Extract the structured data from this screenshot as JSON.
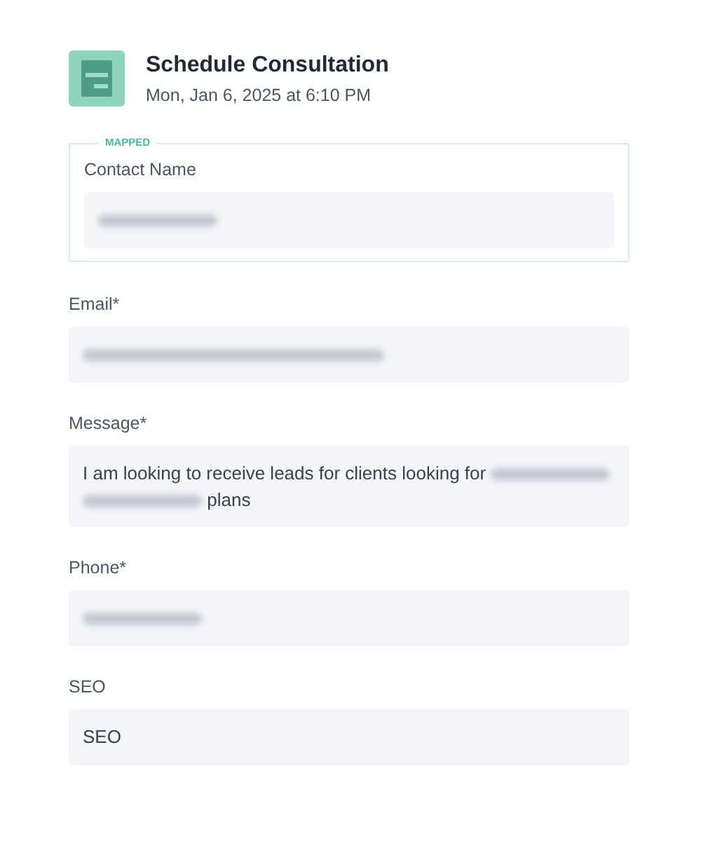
{
  "header": {
    "title": "Schedule Consultation",
    "subtitle": "Mon, Jan 6, 2025 at 6:10 PM"
  },
  "fields": [
    {
      "label": "Contact Name",
      "badge": "MAPPED",
      "parts": [
        {
          "kind": "redacted",
          "wide": false
        }
      ]
    },
    {
      "label": "Email*",
      "parts": [
        {
          "kind": "redacted",
          "wide": true
        }
      ]
    },
    {
      "label": "Message*",
      "parts": [
        {
          "kind": "text",
          "text": "I am looking to receive leads for clients looking for"
        },
        {
          "kind": "redacted",
          "wide": false
        },
        {
          "kind": "redacted",
          "wide": false
        },
        {
          "kind": "text",
          "text": "plans"
        }
      ]
    },
    {
      "label": "Phone*",
      "parts": [
        {
          "kind": "redacted",
          "wide": false
        }
      ]
    },
    {
      "label": "SEO",
      "parts": [
        {
          "kind": "text",
          "text": "SEO"
        }
      ]
    }
  ]
}
